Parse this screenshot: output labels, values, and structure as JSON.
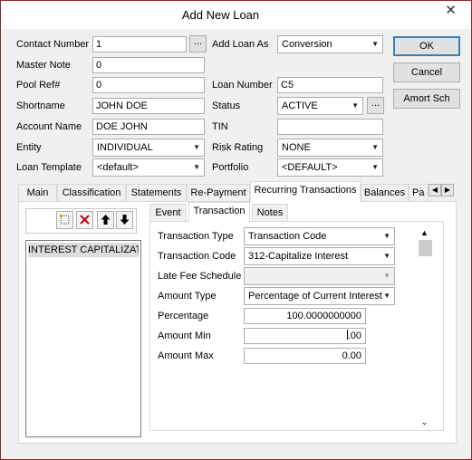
{
  "window": {
    "title": "Add New Loan",
    "close_glyph": "✕"
  },
  "labels": {
    "contact_number": "Contact Number",
    "master_note": "Master Note",
    "pool_ref": "Pool Ref#",
    "shortname": "Shortname",
    "account_name": "Account Name",
    "entity": "Entity",
    "loan_template": "Loan Template",
    "add_loan_as": "Add Loan As",
    "loan_number": "Loan Number",
    "status": "Status",
    "tin": "TIN",
    "risk_rating": "Risk Rating",
    "portfolio": "Portfolio"
  },
  "fields": {
    "contact_number": "1",
    "master_note": "0",
    "pool_ref": "0",
    "shortname": "JOHN DOE",
    "account_name": "DOE JOHN",
    "entity": "INDIVIDUAL",
    "loan_template": "<default>",
    "add_loan_as": "Conversion",
    "loan_number": "C5",
    "status": "ACTIVE",
    "tin": "",
    "risk_rating": "NONE",
    "portfolio": "<DEFAULT>"
  },
  "buttons": {
    "ok": "OK",
    "cancel": "Cancel",
    "amort": "Amort Sch",
    "ellipsis": "..."
  },
  "tabs": [
    "Main",
    "Classification",
    "Statements",
    "Re-Payment",
    "Recurring Transactions",
    "Balances",
    "Pa"
  ],
  "tab_scroll": {
    "left": "◀",
    "right": "▶"
  },
  "transactions_list": [
    "INTEREST CAPITALIZATION"
  ],
  "subtabs": [
    "Event",
    "Transaction",
    "Notes"
  ],
  "transaction_labels": {
    "type": "Transaction Type",
    "code": "Transaction Code",
    "late_fee": "Late Fee Schedule",
    "amount_type": "Amount Type",
    "percentage": "Percentage",
    "amount_min": "Amount Min",
    "amount_max": "Amount Max"
  },
  "transaction_values": {
    "type": "Transaction Code",
    "code": "312-Capitalize Interest",
    "late_fee": "",
    "amount_type": "Percentage of Current Interest",
    "percentage": "100.0000000000",
    "amount_min_before": "",
    "amount_min_after": ".00",
    "amount_max": "0.00"
  },
  "icons": {
    "new": "new-item-icon",
    "delete": "delete-icon",
    "move_up": "arrow-up-icon",
    "move_down": "arrow-down-icon"
  },
  "colors": {
    "window_border": "#8a2a2a",
    "default_button_border": "#3c7fb1",
    "delete_red": "#c00000"
  }
}
